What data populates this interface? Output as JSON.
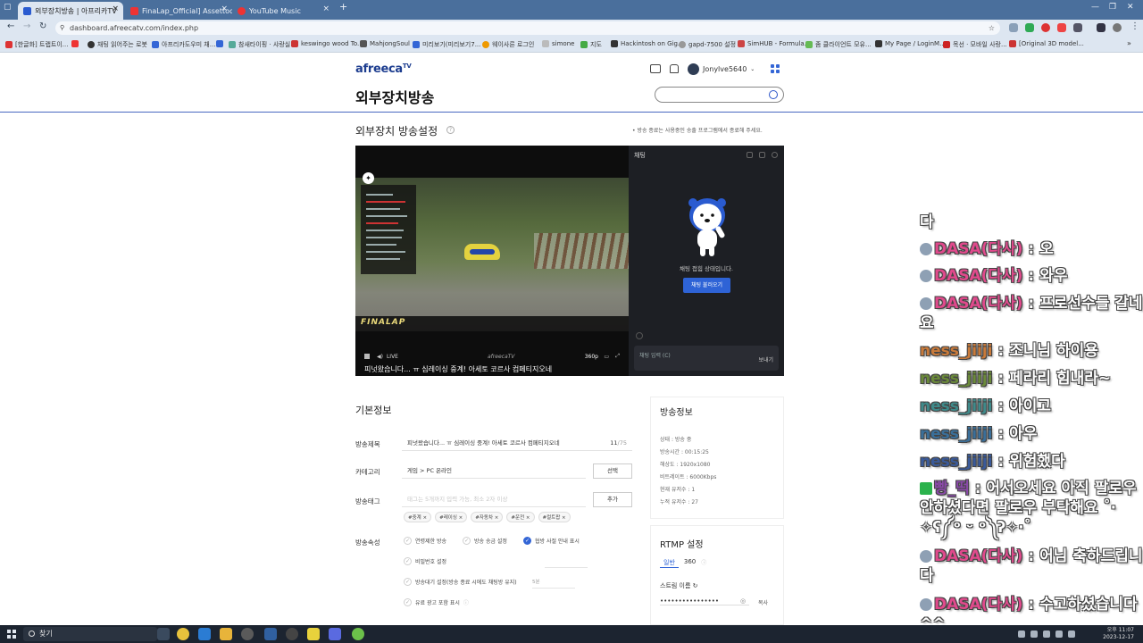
{
  "browser": {
    "tabs": [
      {
        "label": "외부장치방송 | 아프리카TV",
        "active": true
      },
      {
        "label": "FinaLap_Official] Assettocorsa",
        "active": false
      },
      {
        "label": "YouTube Music",
        "active": false
      }
    ],
    "new_tab": "+",
    "url": "dashboard.afreecatv.com/index.php",
    "bookmarks": [
      "[한글화] 트랩트이...",
      "",
      "채팅 읽어주는 로봇",
      "아프리카도우미 채...",
      "",
      "참새타이핑 · 샤랑실...",
      "keswingo wood To...",
      "MahjongSoul",
      "미리보기(미리보기7...",
      "웨이사른 로그인",
      "simone",
      "지도",
      "Hackintosh on Gig...",
      "gapd-7500 설정",
      "SimHUB - Formula...",
      "좀 클라이언트 모유...",
      "My Page / LoginM...",
      "목선 · 모바일 사랑...",
      "[Original 3D model..."
    ]
  },
  "header": {
    "logo": "afreeca",
    "logo_suffix": "TV",
    "page_title": "외부장치방송",
    "username": "Jonylve5640",
    "search_placeholder": ""
  },
  "section": {
    "title": "외부장치 방송설정",
    "help": "?",
    "notice": "• 방송 종료는 사용중인 송출 프로그램에서 종료해 주세요."
  },
  "player": {
    "overlay_brand": "FINALAP",
    "live": "LIVE",
    "player_logo": "afreecaTV",
    "quality": "360p",
    "caption": "피넛왔습니다... ㅠ 심레이싱 중계! 아세토 코르사 컴페티지오네"
  },
  "chat": {
    "label": "채팅",
    "closed_message": "채팅 접힘 상태입니다.",
    "open_button": "채팅 불러오기",
    "input_placeholder": "채팅 입력 (C)",
    "send": "보내기"
  },
  "basic_info": {
    "title": "기본정보",
    "labels": {
      "broadcast_title": "방송제목",
      "category": "카테고리",
      "tags": "방송태그",
      "properties": "방송속성"
    },
    "broadcast_title_value": "피넛왔습니다... ㅠ 심레이싱 중계! 아세토 코르사 컴페티지오네",
    "title_count": "11",
    "title_max": "/75",
    "category_value": "게임 > PC 온라인",
    "select_button": "선택",
    "tag_placeholder": "태그는 5개까지 입력 가능, 최소 2자 이상",
    "add_button": "추가",
    "tags": [
      "#중계",
      "#레이싱",
      "#자동차",
      "#운전",
      "#컬트팝"
    ],
    "options": {
      "restrict": "연령제한 방송",
      "pay": "방송 송금 설정",
      "notice": "협방 사절 안내 표시",
      "password": "비밀번호 설정",
      "standby": "방송대기 설정(방송 종료 시에도 채팅방 유지)",
      "standby_value": "5분",
      "ad": "유료 광고 포함 표시"
    }
  },
  "broadcast_info": {
    "title": "방송정보",
    "lines": [
      "상태 : 방송 중",
      "방송시간 : 00:15:25",
      "해상도 : 1920x1080",
      "비트레이트 : 6000Kbps",
      "현재 유저수 : 1",
      "누적 유저수 : 27"
    ]
  },
  "rtmp": {
    "title": "RTMP 설정",
    "tab_normal": "일반",
    "tab_360": "360",
    "stream_key_label": "스트림 이름",
    "stream_key": "••••••••••••••••",
    "copy": "복사"
  },
  "overlay_chat": [
    {
      "text": "다"
    },
    {
      "name": "DASA(다사)",
      "msg": " : 오",
      "badge": "blue"
    },
    {
      "name": "DASA(다사)",
      "msg": " : 와우",
      "badge": "blue"
    },
    {
      "name": "DASA(다사)",
      "msg": " : 프로선수들 갈네요",
      "badge": "blue"
    },
    {
      "name": "ness_jiiji",
      "msg": " : 조니님 하이용"
    },
    {
      "name": "ness_jiiji",
      "msg": " : 페라리 힘내라~"
    },
    {
      "name": "ness_jiiji",
      "msg": " : 아이고"
    },
    {
      "name": "ness_jiiji",
      "msg": " : 아우"
    },
    {
      "name": "ness_jiiji",
      "msg": " : 위험했다"
    },
    {
      "name": "빵_떡",
      "msg": " : 어서오세요 아직 팔로우 안하셨다면 팔로우 부탁해요 ˚‧✧ʕ༼ᵒ ᵕ ᵒ༽ʔ✧‧˚",
      "badge": "green"
    },
    {
      "name": "DASA(다사)",
      "msg": " : 어님 축하드립니다",
      "badge": "blue"
    },
    {
      "name": "DASA(다사)",
      "msg": " : 수고하셨습니다 ^^",
      "badge": "blue"
    }
  ],
  "taskbar": {
    "search": "찾기",
    "time": "오후 11:07",
    "date": "2023-12-17"
  },
  "colors": {
    "accent": "#2e63d6",
    "header_rule": "#4868c0",
    "overlay_name_dasa": "#e04a8c",
    "overlay_name_ness": "#6b8a3a"
  }
}
